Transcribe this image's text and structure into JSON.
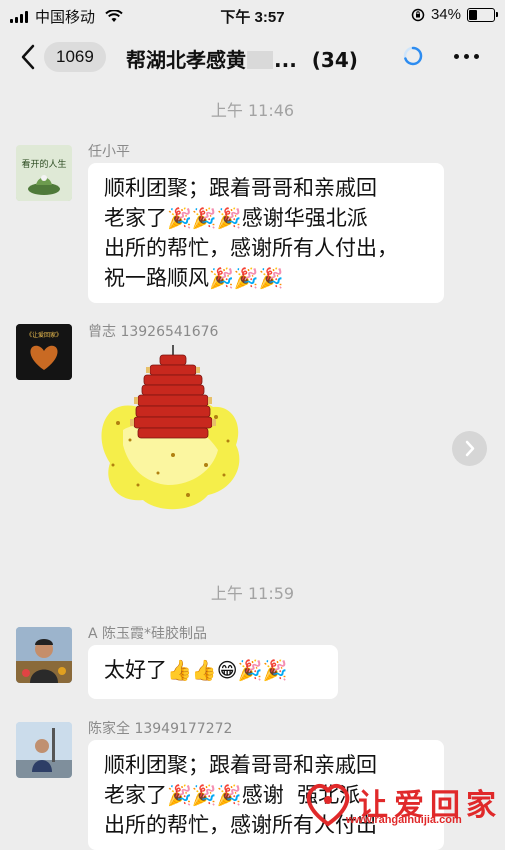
{
  "status_bar": {
    "carrier": "中国移动",
    "time": "下午 3:57",
    "battery": "34%"
  },
  "header": {
    "unread_count": "1069",
    "title_prefix": "帮湖北孝感黄",
    "title_suffix": "...",
    "member_count": "(34)"
  },
  "timestamps": [
    "上午 11:46",
    "上午 11:59"
  ],
  "messages": [
    {
      "sender": "任小平",
      "avatar_caption": "看开的人生",
      "lines": [
        "顺利团聚；跟着哥哥和亲戚回",
        "老家了",
        "感谢华强北派",
        "出所的帮忙，感谢所有人付出，",
        "祝一路顺风"
      ],
      "emoji": "🎉"
    },
    {
      "sender": "曾志 13926541676",
      "avatar_caption": "《让爱回家》",
      "type": "sticker",
      "sticker": "firecracker"
    },
    {
      "sender": "A 陈玉霞*硅胶制品",
      "text": "太好了",
      "emojis": "👍👍😁🎉🎉"
    },
    {
      "sender": "陈家全 13949177272",
      "lines": [
        "顺利团聚；跟着哥哥和亲戚回",
        "老家了",
        "感谢",
        "强北派",
        "出所的帮忙，感谢所有人付出"
      ]
    }
  ],
  "watermark": {
    "text": "让爱回家",
    "url": "www.rangaihuijia.com"
  }
}
